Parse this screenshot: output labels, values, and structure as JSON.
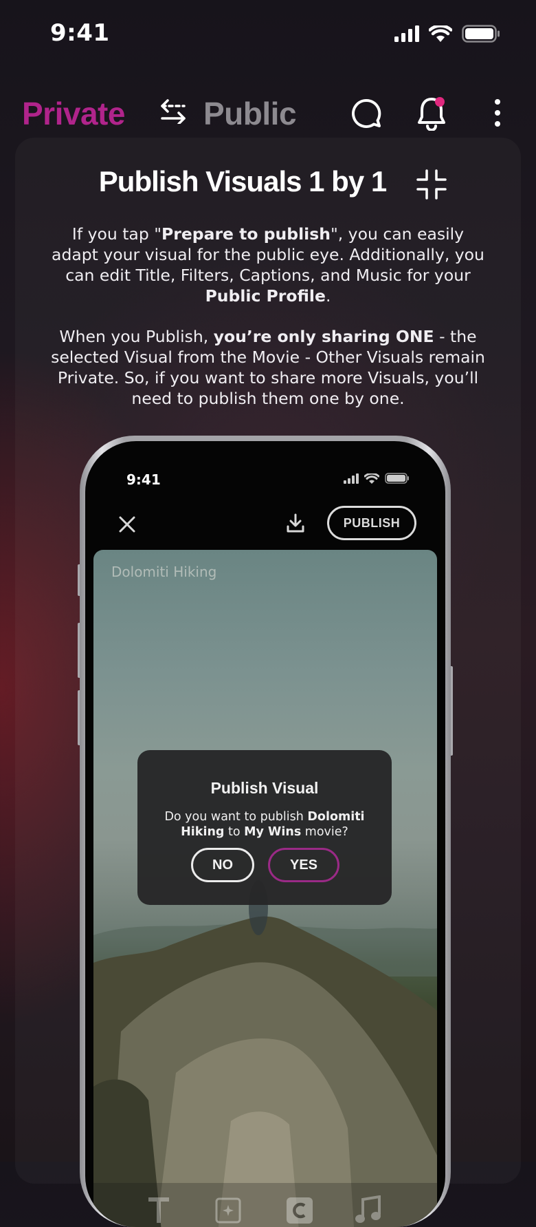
{
  "status": {
    "time": "9:41"
  },
  "nav": {
    "private_label": "Private",
    "public_label": "Public",
    "accent": "#b0248b",
    "notification_dot": "#e0287e"
  },
  "card": {
    "title": "Publish Visuals 1 by 1",
    "desc1": {
      "a": "If you tap \"",
      "b": "Prepare to publish",
      "c": "\", you can easily adapt your visual for the public eye. Additionally, you can edit Title, Filters, Captions, and Music for your ",
      "d": "Public Profile",
      "e": "."
    },
    "desc2": {
      "a": "When you Publish, ",
      "b": "you’re only sharing ONE",
      "c": " - the selected Visual from the Movie - Other Visuals remain Private. So, if you want to share more Visuals, you’ll need to publish them one by one."
    }
  },
  "phone": {
    "time": "9:41",
    "publish_label": "PUBLISH",
    "photo_caption": "Dolomiti Hiking",
    "dialog": {
      "title": "Publish Visual",
      "msg_a": "Do you want to publish ",
      "msg_b": "Dolomiti Hiking",
      "msg_c": " to ",
      "msg_d": "My Wins",
      "msg_e": " movie?",
      "no_label": "NO",
      "yes_label": "YES"
    },
    "tools": [
      "text-tool-icon",
      "filter-tool-icon",
      "caption-tool-icon",
      "music-tool-icon"
    ]
  }
}
